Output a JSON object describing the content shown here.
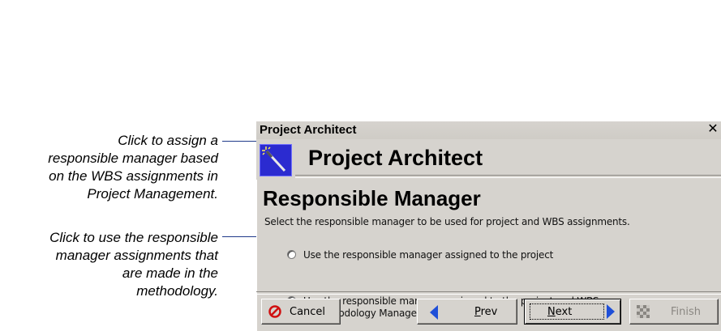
{
  "callouts": {
    "first": [
      "Click to assign a",
      "responsible manager based",
      "on the WBS assignments in",
      "Project Management."
    ],
    "second": [
      "Click to use the responsible",
      "manager assignments that",
      "are made in the",
      "methodology."
    ]
  },
  "window": {
    "title": "Project Architect",
    "close_label": "✕"
  },
  "header": {
    "title": "Project Architect",
    "icon": "wizard-wand-icon"
  },
  "page": {
    "heading": "Responsible Manager",
    "instructions": "Select the responsible manager to be used for project and WBS assignments."
  },
  "options": [
    {
      "label": "Use the responsible manager assigned to the project",
      "selected": false
    },
    {
      "label_line1": "Use the responsible manager assigned to the project and WBS",
      "label_line2": "in Methodology Manager",
      "selected": true
    }
  ],
  "buttons": {
    "cancel": "Cancel",
    "prev": "Prev",
    "next": "Next",
    "finish": "Finish"
  },
  "colors": {
    "dialog_bg": "#d6d3ce",
    "wizard_icon_bg": "#2b2bd0",
    "nav_arrow": "#1f4fd8",
    "cancel_icon": "#d01010",
    "leader_line": "#1f3a8a"
  }
}
